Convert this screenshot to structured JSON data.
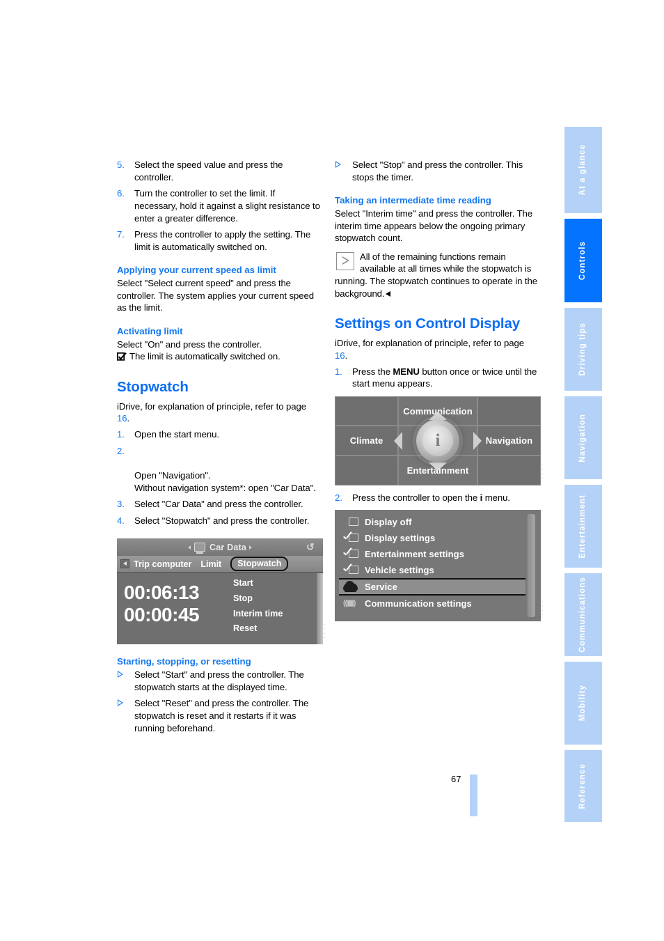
{
  "page": {
    "number": "67",
    "colors": {
      "heading_blue": "#0d6ef5",
      "subheading_blue": "#1478f0",
      "tab_active_blue": "#0473ff",
      "tab_inactive_blue": "#b4d2f7"
    }
  },
  "sidebar": {
    "tabs": [
      {
        "label": "At a glance",
        "active": false
      },
      {
        "label": "Controls",
        "active": true
      },
      {
        "label": "Driving tips",
        "active": false
      },
      {
        "label": "Navigation",
        "active": false
      },
      {
        "label": "Entertainment",
        "active": false
      },
      {
        "label": "Communications",
        "active": false
      },
      {
        "label": "Mobility",
        "active": false
      },
      {
        "label": "Reference",
        "active": false
      }
    ]
  },
  "left_column": {
    "steps_continued": [
      {
        "num": "5.",
        "text": "Select the speed value and press the controller."
      },
      {
        "num": "6.",
        "text": "Turn the controller to set the limit. If necessary, hold it against a slight resistance to enter a greater difference."
      },
      {
        "num": "7.",
        "text": "Press the controller to apply the setting. The limit is automatically switched on."
      }
    ],
    "section_applying": {
      "heading": "Applying your current speed as limit",
      "body": "Select \"Select current speed\" and press the controller. The system applies your current speed as the limit."
    },
    "section_activating": {
      "heading": "Activating limit",
      "body": "Select \"On\" and press the controller.",
      "note": "The limit is automatically switched on.",
      "note_icon": "checkbox-checked-icon"
    },
    "section_stopwatch": {
      "heading": "Stopwatch",
      "intro_prefix": "iDrive, for explanation of principle, refer to page ",
      "intro_pageref": "16",
      "intro_suffix": ".",
      "steps": [
        {
          "num": "1.",
          "text": "Open the start menu."
        },
        {
          "num": "2.",
          "text": "Open \"Navigation\".\nWithout navigation system*: open \"Car Data\"."
        },
        {
          "num": "3.",
          "text": "Select \"Car Data\" and press the controller."
        },
        {
          "num": "4.",
          "text": "Select \"Stopwatch\" and press the controller."
        }
      ]
    },
    "car_data_screen": {
      "title": "Car Data",
      "title_icon": "computer-display-icon",
      "refresh_icon": "refresh-icon",
      "tabs": [
        "Trip computer",
        "Limit",
        "Stopwatch"
      ],
      "selected_tab": "Stopwatch",
      "primary_time": "00:06:13",
      "interim_time": "00:00:45",
      "menu_items": [
        "Start",
        "Stop",
        "Interim time",
        "Reset"
      ]
    },
    "section_starting": {
      "heading": "Starting, stopping, or resetting",
      "bullets": [
        "Select \"Start\" and press the controller. The stopwatch starts at the displayed time.",
        "Select \"Reset\" and press the controller. The stopwatch is reset and it restarts if it was running beforehand."
      ]
    }
  },
  "right_column": {
    "bullets_top": [
      "Select \"Stop\" and press the controller. This stops the timer."
    ],
    "section_interim": {
      "heading": "Taking an intermediate time reading",
      "body": "Select \"Interim time\" and press the controller. The interim time appears below the ongoing primary stopwatch count.",
      "note_icon": "boxed-triangle-icon",
      "note": "All of the remaining functions remain available at all times while the stopwatch is running. The stopwatch continues to operate in the background."
    },
    "section_settings": {
      "heading": "Settings on Control Display",
      "intro_prefix": "iDrive, for explanation of principle, refer to page ",
      "intro_pageref": "16",
      "intro_suffix": ".",
      "step1": {
        "num": "1.",
        "pre": "Press the ",
        "bold": "MENU",
        "post": " button once or twice until the start menu appears."
      },
      "step2": {
        "num": "2.",
        "pre": "Press the controller to open the ",
        "bold": "i",
        "post": " menu."
      }
    },
    "start_menu_screen": {
      "top": "Communication",
      "left": "Climate",
      "right": "Navigation",
      "bottom": "Entertainment",
      "center_icon": "i-info-knob-icon"
    },
    "i_menu_screen": {
      "items": [
        {
          "label": "Display off",
          "icon": "empty-square-icon",
          "selected": false
        },
        {
          "label": "Display settings",
          "icon": "check-square-icon",
          "selected": false
        },
        {
          "label": "Entertainment settings",
          "icon": "check-note-icon",
          "selected": false
        },
        {
          "label": "Vehicle settings",
          "icon": "check-car-icon",
          "selected": false
        },
        {
          "label": "Service",
          "icon": "car-icon",
          "selected": true
        },
        {
          "label": "Communication settings",
          "icon": "antenna-icon",
          "selected": false
        }
      ]
    }
  }
}
